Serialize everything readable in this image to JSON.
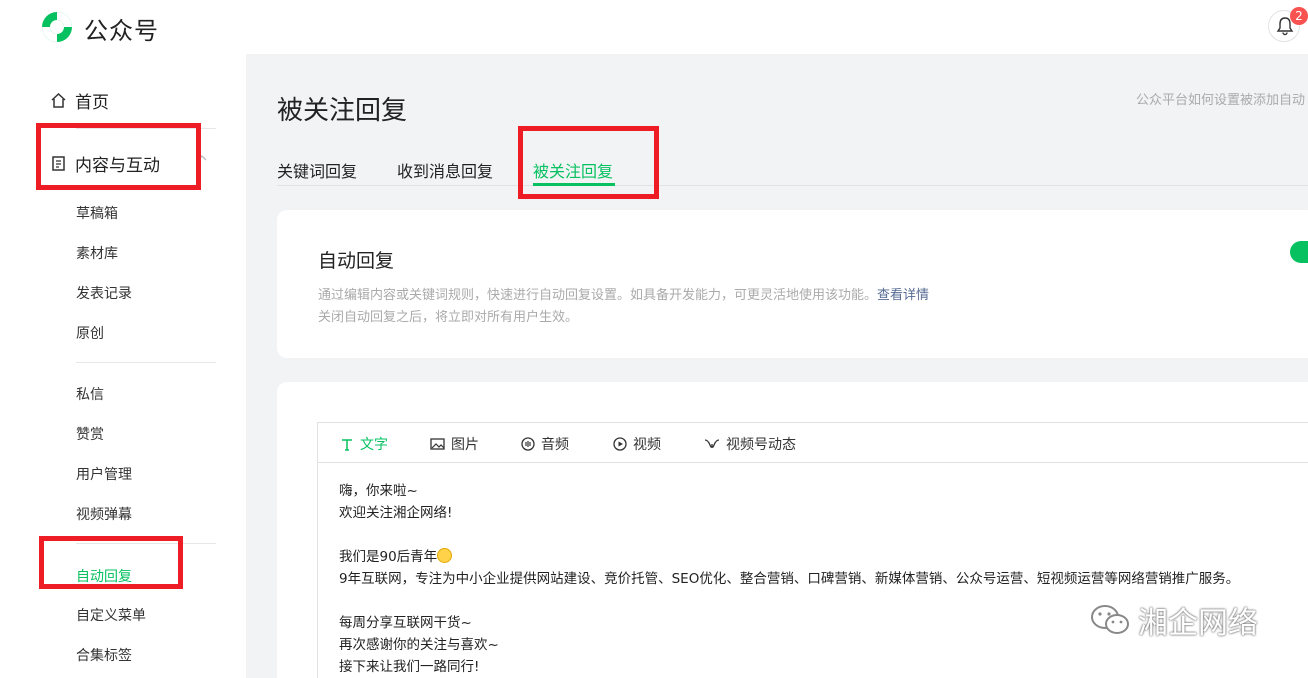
{
  "header": {
    "brand": "公众号",
    "notification_count": "2"
  },
  "sidebar": {
    "home": "首页",
    "content": "内容与互动",
    "items_group1": [
      "草稿箱",
      "素材库",
      "发表记录",
      "原创"
    ],
    "items_group2": [
      "私信",
      "赞赏",
      "用户管理",
      "视频弹幕"
    ],
    "items_group3": [
      "自动回复",
      "自定义菜单",
      "合集标签"
    ]
  },
  "main": {
    "title": "被关注回复",
    "help_link": "公众平台如何设置被添加自动",
    "tabs": [
      "关键词回复",
      "收到消息回复",
      "被关注回复"
    ],
    "auto_reply": {
      "title": "自动回复",
      "desc": "通过编辑内容或关键词规则，快速进行自动回复设置。如具备开发能力，可更灵活地使用该功能。",
      "detail_link": "查看详情",
      "desc2": "关闭自动回复之后，将立即对所有用户生效。"
    },
    "editor": {
      "tools": [
        "文字",
        "图片",
        "音频",
        "视频",
        "视频号动态"
      ],
      "lines": [
        "嗨，你来啦~",
        "欢迎关注湘企网络!",
        "",
        "我们是90后青年",
        "9年互联网，专注为中小企业提供网站建设、竞价托管、SEO优化、整合营销、口碑营销、新媒体营销、公众号运营、短视频运营等网络营销推广服务。",
        "",
        "每周分享互联网干货~",
        "再次感谢你的关注与喜欢~",
        "接下来让我们一路同行!"
      ]
    }
  },
  "watermark": "湘企网络",
  "colors": {
    "accent": "#07c160",
    "annotation": "#ee1c25",
    "link": "#576b95"
  }
}
